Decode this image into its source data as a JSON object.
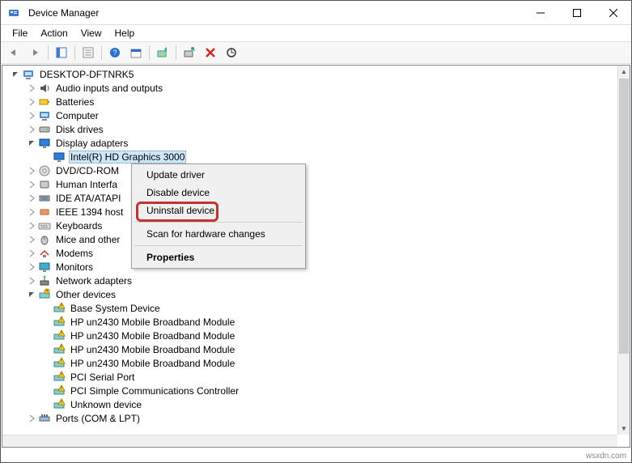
{
  "title": "Device Manager",
  "menubar": [
    "File",
    "Action",
    "View",
    "Help"
  ],
  "context_menu": {
    "items": [
      {
        "label": "Update driver",
        "sep_after": false,
        "bold": false
      },
      {
        "label": "Disable device",
        "sep_after": false,
        "bold": false
      },
      {
        "label": "Uninstall device",
        "sep_after": true,
        "bold": false,
        "highlight": true
      },
      {
        "label": "Scan for hardware changes",
        "sep_after": true,
        "bold": false
      },
      {
        "label": "Properties",
        "sep_after": false,
        "bold": true
      }
    ]
  },
  "tree": [
    {
      "depth": 0,
      "exp": "open",
      "icon": "computer",
      "label": "DESKTOP-DFTNRK5"
    },
    {
      "depth": 1,
      "exp": "closed",
      "icon": "audio",
      "label": "Audio inputs and outputs"
    },
    {
      "depth": 1,
      "exp": "closed",
      "icon": "battery",
      "label": "Batteries"
    },
    {
      "depth": 1,
      "exp": "closed",
      "icon": "computer",
      "label": "Computer"
    },
    {
      "depth": 1,
      "exp": "closed",
      "icon": "disk",
      "label": "Disk drives"
    },
    {
      "depth": 1,
      "exp": "open",
      "icon": "display",
      "label": "Display adapters"
    },
    {
      "depth": 2,
      "exp": "none",
      "icon": "display",
      "label": "Intel(R) HD Graphics 3000",
      "selected": true
    },
    {
      "depth": 1,
      "exp": "closed",
      "icon": "dvd",
      "label": "DVD/CD-ROM"
    },
    {
      "depth": 1,
      "exp": "closed",
      "icon": "hid",
      "label": "Human Interfa"
    },
    {
      "depth": 1,
      "exp": "closed",
      "icon": "ide",
      "label": "IDE ATA/ATAPI"
    },
    {
      "depth": 1,
      "exp": "closed",
      "icon": "ieee",
      "label": "IEEE 1394 host"
    },
    {
      "depth": 1,
      "exp": "closed",
      "icon": "keyboard",
      "label": "Keyboards"
    },
    {
      "depth": 1,
      "exp": "closed",
      "icon": "mouse",
      "label": "Mice and other"
    },
    {
      "depth": 1,
      "exp": "closed",
      "icon": "modem",
      "label": "Modems"
    },
    {
      "depth": 1,
      "exp": "closed",
      "icon": "monitor",
      "label": "Monitors"
    },
    {
      "depth": 1,
      "exp": "closed",
      "icon": "network",
      "label": "Network adapters"
    },
    {
      "depth": 1,
      "exp": "open",
      "icon": "other",
      "label": "Other devices"
    },
    {
      "depth": 2,
      "exp": "none",
      "icon": "warn",
      "label": "Base System Device"
    },
    {
      "depth": 2,
      "exp": "none",
      "icon": "warn",
      "label": "HP un2430 Mobile Broadband Module"
    },
    {
      "depth": 2,
      "exp": "none",
      "icon": "warn",
      "label": "HP un2430 Mobile Broadband Module"
    },
    {
      "depth": 2,
      "exp": "none",
      "icon": "warn",
      "label": "HP un2430 Mobile Broadband Module"
    },
    {
      "depth": 2,
      "exp": "none",
      "icon": "warn",
      "label": "HP un2430 Mobile Broadband Module"
    },
    {
      "depth": 2,
      "exp": "none",
      "icon": "warn",
      "label": "PCI Serial Port"
    },
    {
      "depth": 2,
      "exp": "none",
      "icon": "warn",
      "label": "PCI Simple Communications Controller"
    },
    {
      "depth": 2,
      "exp": "none",
      "icon": "warn",
      "label": "Unknown device"
    },
    {
      "depth": 1,
      "exp": "closed",
      "icon": "ports",
      "label": "Ports (COM & LPT)"
    }
  ],
  "watermark": "wsxdn.com"
}
